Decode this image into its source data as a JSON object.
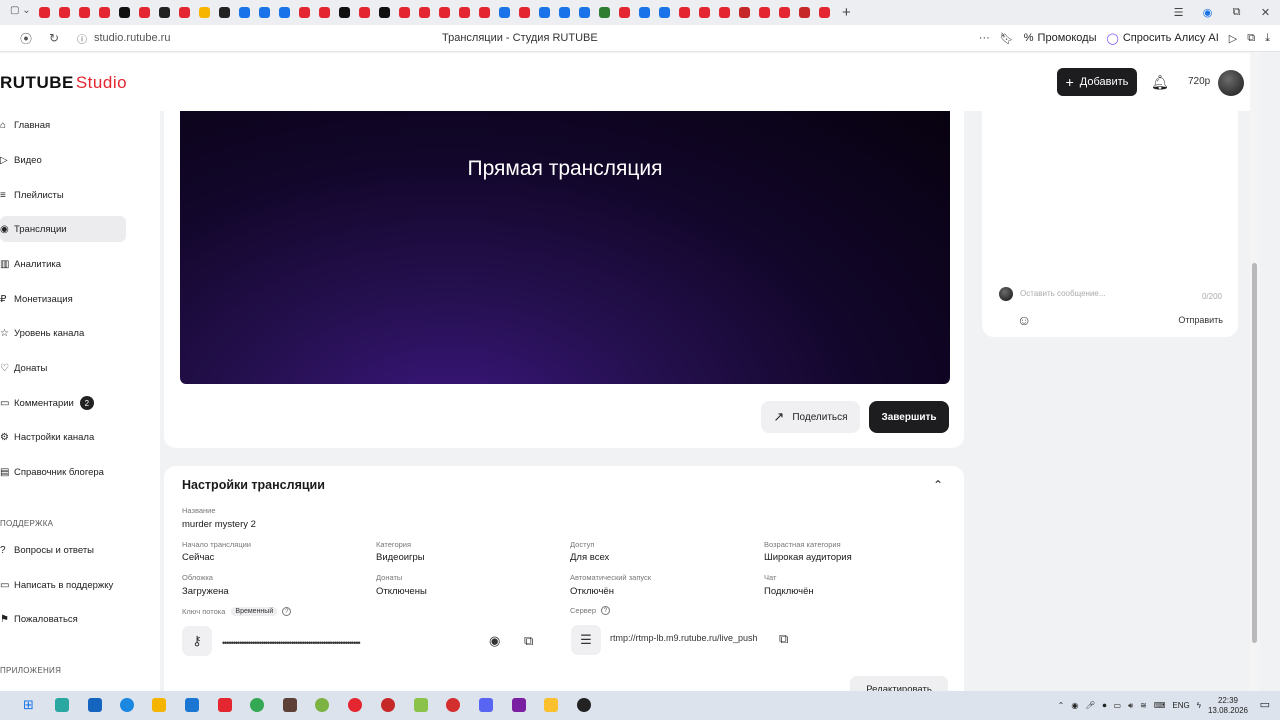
{
  "browser": {
    "url": "studio.rutube.ru",
    "page_title": "Трансляции - Студия RUTUBE",
    "promo_label": "Промокоды",
    "alice_label": "Спросить Алису AI",
    "tab_colors": [
      "#e3262f",
      "#e3262f",
      "#e3262f",
      "#e3262f",
      "#111111",
      "#e3262f",
      "#222222",
      "#e3262f",
      "#f7b500",
      "#222222",
      "#1a73e8",
      "#1a73e8",
      "#1a73e8",
      "#e3262f",
      "#e3262f",
      "#111111",
      "#e3262f",
      "#111111",
      "#e3262f",
      "#e3262f",
      "#e3262f",
      "#e3262f",
      "#e3262f",
      "#1a73e8",
      "#e3262f",
      "#1a73e8",
      "#1a73e8",
      "#1a73e8",
      "#2e7d32",
      "#e3262f",
      "#1a73e8",
      "#1a73e8",
      "#e3262f",
      "#e3262f",
      "#e3262f",
      "#c62828",
      "#e3262f",
      "#e3262f",
      "#c62828",
      "#e3262f"
    ]
  },
  "header": {
    "logo_main": "RUTUBE",
    "logo_sub": "Studio",
    "add_label": "Добавить",
    "quality": "720p"
  },
  "sidebar": {
    "items": [
      {
        "label": "Главная",
        "icon": "home-icon"
      },
      {
        "label": "Видео",
        "icon": "video-icon"
      },
      {
        "label": "Плейлисты",
        "icon": "playlist-icon"
      },
      {
        "label": "Трансляции",
        "icon": "broadcast-icon"
      },
      {
        "label": "Аналитика",
        "icon": "analytics-icon"
      },
      {
        "label": "Монетизация",
        "icon": "monetization-icon"
      },
      {
        "label": "Уровень канала",
        "icon": "level-icon"
      },
      {
        "label": "Донаты",
        "icon": "donate-icon"
      },
      {
        "label": "Комментарии",
        "icon": "comment-icon",
        "badge": "2"
      },
      {
        "label": "Настройки канала",
        "icon": "settings-icon"
      },
      {
        "label": "Справочник блогера",
        "icon": "guide-icon"
      }
    ],
    "support_title": "ПОДДЕРЖКА",
    "support_items": [
      {
        "label": "Вопросы и ответы"
      },
      {
        "label": "Написать в поддержку"
      },
      {
        "label": "Пожаловаться"
      }
    ],
    "apps_title": "ПРИЛОЖЕНИЯ"
  },
  "player": {
    "title": "Прямая трансляция"
  },
  "actions": {
    "share": "Поделиться",
    "finish": "Завершить"
  },
  "chat": {
    "placeholder": "Оставить сообщение...",
    "counter": "0/200",
    "send": "Отправить"
  },
  "settings": {
    "title": "Настройки трансляции",
    "name_label": "Название",
    "name_value": "murder mystery 2",
    "fields": [
      {
        "label": "Начало трансляции",
        "value": "Сейчас"
      },
      {
        "label": "Категория",
        "value": "Видеоигры"
      },
      {
        "label": "Доступ",
        "value": "Для всех"
      },
      {
        "label": "Возрастная категория",
        "value": "Широкая аудитория"
      },
      {
        "label": "Обложка",
        "value": "Загружена"
      },
      {
        "label": "Донаты",
        "value": "Отключены"
      },
      {
        "label": "Автоматический запуск",
        "value": "Отключён"
      },
      {
        "label": "Чат",
        "value": "Подключён"
      }
    ],
    "key_label": "Ключ потока",
    "key_tag": "Временный",
    "key_masked": "••••••••••••••••••••••••••••••••••••••••••••••••••••••••••••••••",
    "server_label": "Сервер",
    "server_value": "rtmp://rtmp-lb.m9.rutube.ru/live_push",
    "edit": "Редактировать"
  },
  "taskbar": {
    "lang": "ENG",
    "time": "22:39",
    "date": "13.08.2026"
  }
}
